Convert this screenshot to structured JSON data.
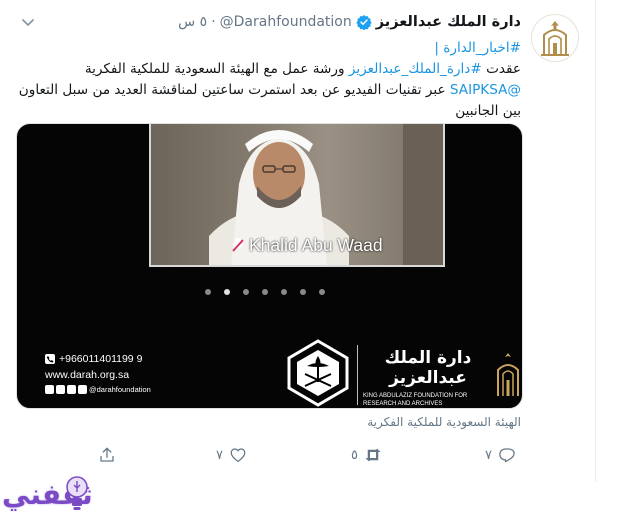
{
  "tweet": {
    "display_name": "دارة الملك عبدالعزيز",
    "handle": "@Darahfoundation",
    "separator": "·",
    "time": "٥ س",
    "hashtag_line": "#اخبار_الدارة |",
    "body_prefix": "عقدت ",
    "body_hashtag": "#دارة_الملك_عبدالعزيز",
    "body_middle": " ورشة عمل مع الهيئة السعودية للملكية الفكرية ",
    "body_mention": "@SAIPKSA",
    "body_suffix": " عبر تقنيات الفيديو عن بعد استمرت ساعتين لمناقشة العديد من سبل التعاون بين الجانبين"
  },
  "media": {
    "speaker_name": "Khalid Abu Waad",
    "carousel_count": 7,
    "carousel_active_index": 1,
    "phone": "+966011401199 9",
    "website": "www.darah.org.sa",
    "social_handle": "@darahfoundation",
    "brand_arabic": "دارة الملك عبدالعزيز",
    "brand_english": "KING ABDULAZIZ FOUNDATION FOR RESEARCH AND ARCHIVES"
  },
  "caption": "الهيئة السعودية للملكية الفكرية",
  "actions": {
    "reply_count": "٧",
    "retweet_count": "٥",
    "like_count": "٧"
  },
  "watermark": {
    "text": "ثقفني"
  },
  "colors": {
    "link": "#1b95e0",
    "muted": "#657786",
    "verified": "#1da1f2"
  },
  "icons": [
    "verified-badge-icon",
    "chevron-down-icon",
    "microphone-icon",
    "phone-icon",
    "reply-icon",
    "retweet-icon",
    "like-icon",
    "share-icon",
    "lightbulb-icon"
  ]
}
